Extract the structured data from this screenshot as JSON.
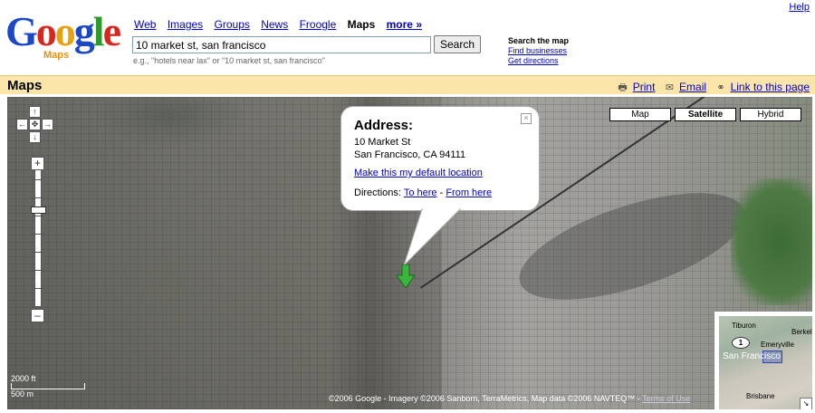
{
  "header": {
    "help_label": "Help",
    "logo": {
      "letters": [
        {
          "ch": "G",
          "color": "#1a48c8"
        },
        {
          "ch": "o",
          "color": "#d6281e"
        },
        {
          "ch": "o",
          "color": "#e8a112"
        },
        {
          "ch": "g",
          "color": "#1a48c8"
        },
        {
          "ch": "l",
          "color": "#2a9a2a"
        },
        {
          "ch": "e",
          "color": "#d6281e"
        }
      ],
      "product": "Maps"
    },
    "nav": {
      "web": "Web",
      "images": "Images",
      "groups": "Groups",
      "news": "News",
      "froogle": "Froogle",
      "maps": "Maps",
      "more": "more »"
    },
    "search": {
      "value": "10 market st, san francisco",
      "button": "Search",
      "example": "e.g., \"hotels near lax\" or \"10 market st, san francisco\""
    },
    "side_links": {
      "heading": "Search the map",
      "find_businesses": "Find businesses",
      "get_directions": "Get directions"
    }
  },
  "toolbar": {
    "title": "Maps",
    "print": "Print",
    "email": "Email",
    "link": "Link to this page",
    "print_icon": "printer-icon",
    "email_icon": "envelope-icon",
    "link_icon": "chain-link-icon"
  },
  "map": {
    "types": {
      "map": "Map",
      "satellite": "Satellite",
      "hybrid": "Hybrid",
      "active": "Satellite"
    },
    "controls": {
      "up": "↑",
      "left": "←",
      "center": "✥",
      "right": "→",
      "down": "↓",
      "zoom_in": "+",
      "zoom_out": "–"
    },
    "info_window": {
      "title": "Address:",
      "line1": "10 Market St",
      "line2": "San Francisco, CA 94111",
      "default_link": "Make this my default location",
      "directions_label": "Directions:",
      "to_here": "To here",
      "separator": "-",
      "from_here": "From here",
      "close": "×"
    },
    "scale": {
      "ft": "2000 ft",
      "m": "500 m"
    },
    "copyright": "©2006 Google - Imagery ©2006 Sanborn, TerraMetrics, Map data ©2006 NAVTEQ™ - ",
    "terms": "Terms of Use",
    "overview": {
      "tiburon": "Tiburon",
      "berkeley": "Berkel",
      "emeryville": "Emeryville",
      "san_francisco": "San Francisco",
      "brisbane": "Brisbane",
      "badge": "1",
      "corner": "↘"
    }
  },
  "colors": {
    "link": "#0000cc",
    "toolbar_bg": "#fce5a8",
    "marker": "#3bb53b"
  }
}
